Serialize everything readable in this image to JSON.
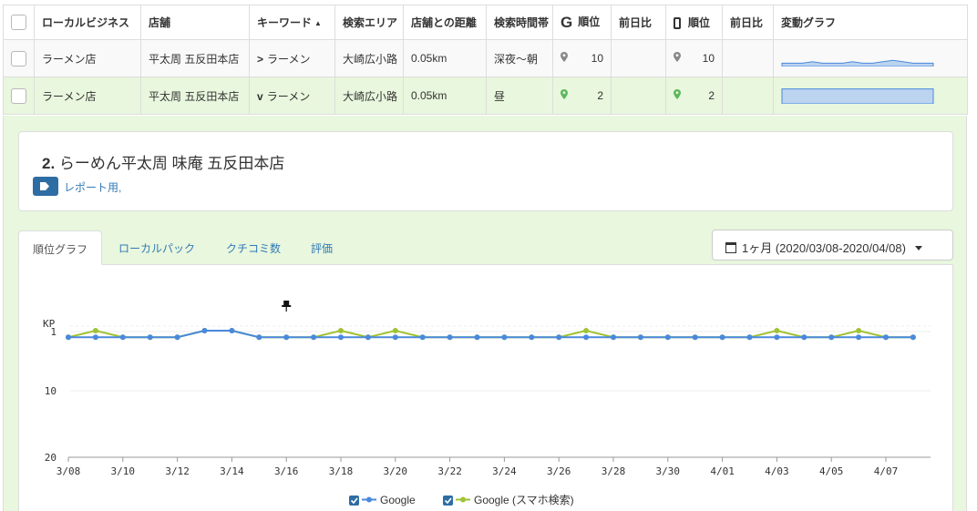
{
  "table": {
    "headers": {
      "business": "ローカルビジネス",
      "shop": "店舗",
      "keyword": "キーワード",
      "area": "検索エリア",
      "distance": "店舗との距離",
      "time": "検索時間帯",
      "g_rank": "順位",
      "g_prev": "前日比",
      "m_rank": "順位",
      "m_prev": "前日比",
      "graph": "変動グラフ"
    },
    "sort_indicator": "▲",
    "google_logo": "G",
    "rows": [
      {
        "business": "ラーメン店",
        "shop": "平太周 五反田本店",
        "arrow": ">",
        "keyword": "ラーメン",
        "area": "大崎広小路",
        "distance": "0.05km",
        "time": "深夜〜朝",
        "g_rank": "10",
        "g_prev": "",
        "m_rank": "10",
        "m_prev": "",
        "pin_color": "#888888"
      },
      {
        "business": "ラーメン店",
        "shop": "平太周 五反田本店",
        "arrow": "v",
        "keyword": "ラーメン",
        "area": "大崎広小路",
        "distance": "0.05km",
        "time": "昼",
        "g_rank": "2",
        "g_prev": "",
        "m_rank": "2",
        "m_prev": "",
        "pin_color": "#5cb85c"
      }
    ]
  },
  "detail": {
    "shop_number": "2.",
    "shop_name": "らーめん平太周 味庵 五反田本店",
    "tag_label": "レポート用,",
    "tabs": [
      "順位グラフ",
      "ローカルパック",
      "クチコミ数",
      "評価"
    ],
    "active_tab": 0,
    "date_range": "1ヶ月 (2020/03/08-2020/04/08)",
    "colors": {
      "google": "#4a89dc",
      "mobile": "#a0c234",
      "row_highlight": "#e8f7dd"
    }
  },
  "chart_data": {
    "type": "line",
    "y_axis_marker": "KP",
    "y_ticks": [
      "1",
      "10",
      "20"
    ],
    "ylim": [
      20,
      0
    ],
    "x_tick_labels": [
      "3/08",
      "3/10",
      "3/12",
      "3/14",
      "3/16",
      "3/18",
      "3/20",
      "3/22",
      "3/24",
      "3/26",
      "3/28",
      "3/30",
      "4/01",
      "4/03",
      "4/05",
      "4/07"
    ],
    "x": [
      "3/08",
      "3/09",
      "3/10",
      "3/11",
      "3/12",
      "3/13",
      "3/14",
      "3/15",
      "3/16",
      "3/17",
      "3/18",
      "3/19",
      "3/20",
      "3/21",
      "3/22",
      "3/23",
      "3/24",
      "3/25",
      "3/26",
      "3/27",
      "3/28",
      "3/29",
      "3/30",
      "3/31",
      "4/01",
      "4/02",
      "4/03",
      "4/04",
      "4/05",
      "4/06",
      "4/07",
      "4/08"
    ],
    "pin_marker_index": 8,
    "series": [
      {
        "name": "Google",
        "color": "#4a89dc",
        "values": [
          2,
          2,
          2,
          2,
          2,
          1,
          1,
          2,
          2,
          2,
          2,
          2,
          2,
          2,
          2,
          2,
          2,
          2,
          2,
          2,
          2,
          2,
          2,
          2,
          2,
          2,
          2,
          2,
          2,
          2,
          2,
          2
        ]
      },
      {
        "name": "Google (スマホ検索)",
        "color": "#a0c234",
        "values": [
          2,
          1,
          2,
          2,
          2,
          1,
          1,
          2,
          2,
          2,
          1,
          2,
          1,
          2,
          2,
          2,
          2,
          2,
          2,
          1,
          2,
          2,
          2,
          2,
          2,
          2,
          1,
          2,
          2,
          1,
          2,
          2
        ]
      }
    ],
    "sparklines": [
      {
        "values": [
          10,
          10,
          10,
          9,
          10,
          10,
          10,
          9,
          10,
          10,
          9,
          8,
          9,
          10,
          10,
          10
        ]
      },
      {
        "values": [
          2,
          2,
          2,
          2,
          2,
          2,
          2,
          2,
          2,
          2,
          2,
          2,
          2,
          2,
          2,
          2
        ]
      }
    ]
  }
}
